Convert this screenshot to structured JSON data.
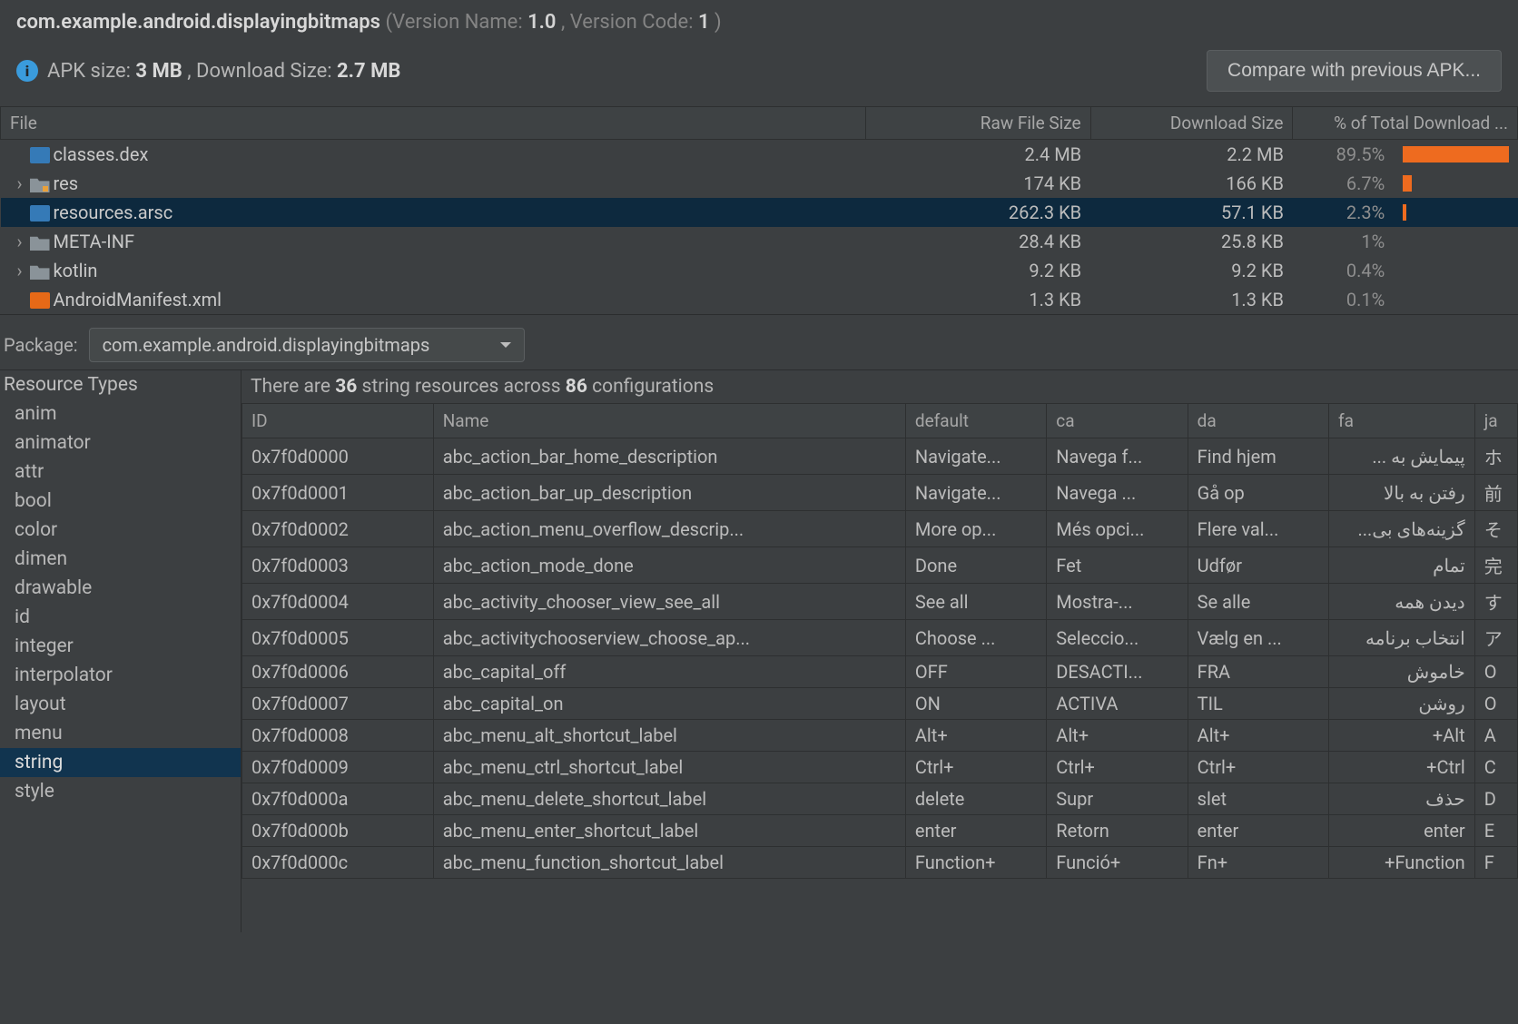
{
  "header": {
    "package_name": "com.example.android.displayingbitmaps",
    "version_name_label": " (Version Name: ",
    "version_name": "1.0",
    "version_code_label": ", Version Code: ",
    "version_code": "1",
    "apk_size_label": "APK size: ",
    "apk_size": "3 MB",
    "dl_size_label": ", Download Size: ",
    "dl_size": "2.7 MB",
    "compare_btn": "Compare with previous APK..."
  },
  "file_columns": {
    "file": "File",
    "raw": "Raw File Size",
    "dl": "Download Size",
    "pct": "% of Total Download ..."
  },
  "files": [
    {
      "name": "classes.dex",
      "icon": "dex",
      "chev": "",
      "raw": "2.4 MB",
      "dl": "2.2 MB",
      "pct": "89.5%",
      "bar": 100,
      "sel": false
    },
    {
      "name": "res",
      "icon": "folder-o",
      "chev": "›",
      "raw": "174 KB",
      "dl": "166 KB",
      "pct": "6.7%",
      "bar": 8,
      "sel": false
    },
    {
      "name": "resources.arsc",
      "icon": "arsc",
      "chev": "",
      "raw": "262.3 KB",
      "dl": "57.1 KB",
      "pct": "2.3%",
      "bar": 3,
      "sel": true
    },
    {
      "name": "META-INF",
      "icon": "folder",
      "chev": "›",
      "raw": "28.4 KB",
      "dl": "25.8 KB",
      "pct": "1%",
      "bar": 0,
      "sel": false
    },
    {
      "name": "kotlin",
      "icon": "folder",
      "chev": "›",
      "raw": "9.2 KB",
      "dl": "9.2 KB",
      "pct": "0.4%",
      "bar": 0,
      "sel": false
    },
    {
      "name": "AndroidManifest.xml",
      "icon": "xml",
      "chev": "",
      "raw": "1.3 KB",
      "dl": "1.3 KB",
      "pct": "0.1%",
      "bar": 0,
      "sel": false
    }
  ],
  "package_row": {
    "label": "Package:",
    "selected": "com.example.android.displayingbitmaps"
  },
  "restypes_title": "Resource Types",
  "restypes": [
    "anim",
    "animator",
    "attr",
    "bool",
    "color",
    "dimen",
    "drawable",
    "id",
    "integer",
    "interpolator",
    "layout",
    "menu",
    "string",
    "style"
  ],
  "restypes_selected": "string",
  "summary": {
    "prefix": "There are ",
    "n1": "36",
    "mid": " string resources across ",
    "n2": "86",
    "suffix": " configurations"
  },
  "res_columns": [
    "ID",
    "Name",
    "default",
    "ca",
    "da",
    "fa",
    "ja"
  ],
  "res_rows": [
    {
      "id": "0x7f0d0000",
      "name": "abc_action_bar_home_description",
      "def": "Navigate...",
      "ca": "Navega f...",
      "da": "Find hjem",
      "fa": "پیمایش به ...",
      "ja": "ホ"
    },
    {
      "id": "0x7f0d0001",
      "name": "abc_action_bar_up_description",
      "def": "Navigate...",
      "ca": "Navega ...",
      "da": "Gå op",
      "fa": "رفتن به بالا",
      "ja": "前"
    },
    {
      "id": "0x7f0d0002",
      "name": "abc_action_menu_overflow_descrip...",
      "def": "More op...",
      "ca": "Més opci...",
      "da": "Flere val...",
      "fa": "گزینه‌های بی...",
      "ja": "そ"
    },
    {
      "id": "0x7f0d0003",
      "name": "abc_action_mode_done",
      "def": "Done",
      "ca": "Fet",
      "da": "Udfør",
      "fa": "تمام",
      "ja": "完"
    },
    {
      "id": "0x7f0d0004",
      "name": "abc_activity_chooser_view_see_all",
      "def": "See all",
      "ca": "Mostra-...",
      "da": "Se alle",
      "fa": "دیدن همه",
      "ja": "す"
    },
    {
      "id": "0x7f0d0005",
      "name": "abc_activitychooserview_choose_ap...",
      "def": "Choose ...",
      "ca": "Seleccio...",
      "da": "Vælg en ...",
      "fa": "انتخاب برنامه",
      "ja": "ア"
    },
    {
      "id": "0x7f0d0006",
      "name": "abc_capital_off",
      "def": "OFF",
      "ca": "DESACTI...",
      "da": "FRA",
      "fa": "خاموش",
      "ja": "O"
    },
    {
      "id": "0x7f0d0007",
      "name": "abc_capital_on",
      "def": "ON",
      "ca": "ACTIVA",
      "da": "TIL",
      "fa": "روشن",
      "ja": "O"
    },
    {
      "id": "0x7f0d0008",
      "name": "abc_menu_alt_shortcut_label",
      "def": "Alt+",
      "ca": "Alt+",
      "da": "Alt+",
      "fa": "Alt+",
      "ja": "A"
    },
    {
      "id": "0x7f0d0009",
      "name": "abc_menu_ctrl_shortcut_label",
      "def": "Ctrl+",
      "ca": "Ctrl+",
      "da": "Ctrl+",
      "fa": "Ctrl+",
      "ja": "C"
    },
    {
      "id": "0x7f0d000a",
      "name": "abc_menu_delete_shortcut_label",
      "def": "delete",
      "ca": "Supr",
      "da": "slet",
      "fa": "حذف",
      "ja": "D"
    },
    {
      "id": "0x7f0d000b",
      "name": "abc_menu_enter_shortcut_label",
      "def": "enter",
      "ca": "Retorn",
      "da": "enter",
      "fa": "enter",
      "ja": "E"
    },
    {
      "id": "0x7f0d000c",
      "name": "abc_menu_function_shortcut_label",
      "def": "Function+",
      "ca": "Funció+",
      "da": "Fn+",
      "fa": "Function+",
      "ja": "F"
    }
  ]
}
